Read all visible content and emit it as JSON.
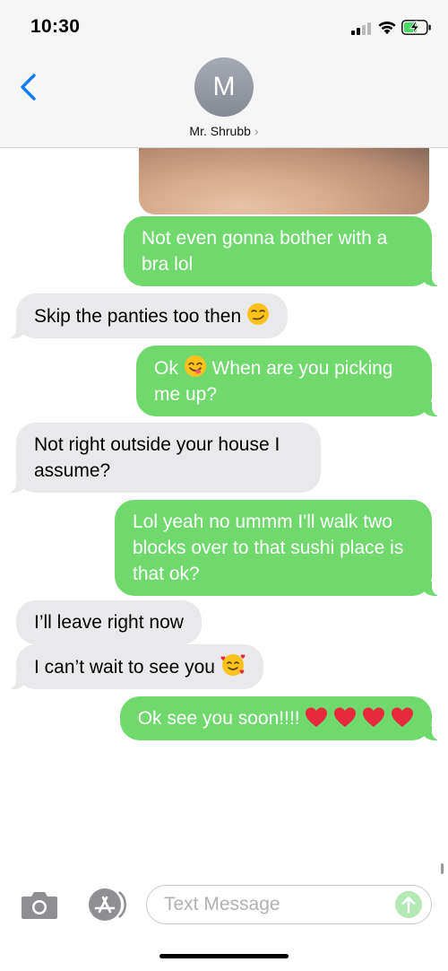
{
  "status_bar": {
    "time": "10:30"
  },
  "header": {
    "avatar_initial": "M",
    "contact_name": "Mr. Shrubb",
    "chevron": "›"
  },
  "colors": {
    "sent_bubble": "#70d96e",
    "received_bubble": "#e9e9eb",
    "accent": "#0a7aff",
    "header_bg": "#f6f6f6"
  },
  "messages": [
    {
      "direction": "sent",
      "text": "Not even gonna bother with a bra lol"
    },
    {
      "direction": "received",
      "text": "Skip the panties too then",
      "emoji": "smirking-face"
    },
    {
      "direction": "sent",
      "text_before": "Ok",
      "emoji": "face-savoring-food",
      "text_after": "When are you picking me up?"
    },
    {
      "direction": "received",
      "text": "Not right outside your house I assume?"
    },
    {
      "direction": "sent",
      "text": "Lol yeah no ummm I'll walk two blocks over to that sushi place is that ok?"
    },
    {
      "direction": "received",
      "text": "I’ll leave right now"
    },
    {
      "direction": "received",
      "text": "I can’t wait to see you",
      "emoji": "smiling-face-with-hearts"
    },
    {
      "direction": "sent",
      "text": "Ok see you soon!!!!",
      "emoji": "red-heart",
      "emoji_count": 4
    }
  ],
  "input_bar": {
    "placeholder": "Text Message"
  },
  "icons": [
    "back-chevron-icon",
    "signal-icon",
    "wifi-icon",
    "battery-charging-icon",
    "camera-icon",
    "app-store-icon",
    "send-arrow-icon"
  ]
}
